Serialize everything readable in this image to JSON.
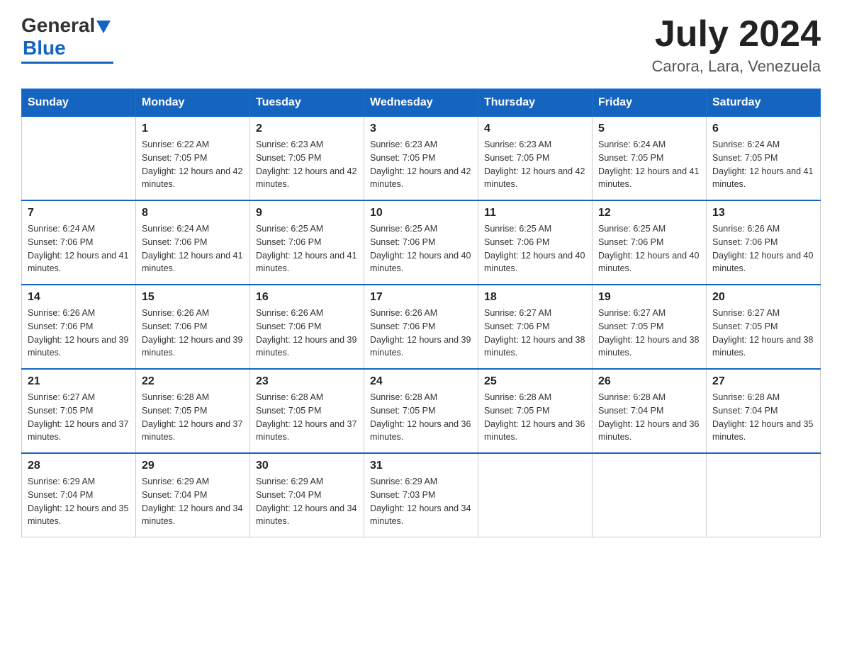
{
  "header": {
    "logo": {
      "general": "General",
      "blue": "Blue"
    },
    "title": "July 2024",
    "location": "Carora, Lara, Venezuela"
  },
  "days_of_week": [
    "Sunday",
    "Monday",
    "Tuesday",
    "Wednesday",
    "Thursday",
    "Friday",
    "Saturday"
  ],
  "weeks": [
    [
      {
        "day": "",
        "info": ""
      },
      {
        "day": "1",
        "info": "Sunrise: 6:22 AM\nSunset: 7:05 PM\nDaylight: 12 hours and 42 minutes."
      },
      {
        "day": "2",
        "info": "Sunrise: 6:23 AM\nSunset: 7:05 PM\nDaylight: 12 hours and 42 minutes."
      },
      {
        "day": "3",
        "info": "Sunrise: 6:23 AM\nSunset: 7:05 PM\nDaylight: 12 hours and 42 minutes."
      },
      {
        "day": "4",
        "info": "Sunrise: 6:23 AM\nSunset: 7:05 PM\nDaylight: 12 hours and 42 minutes."
      },
      {
        "day": "5",
        "info": "Sunrise: 6:24 AM\nSunset: 7:05 PM\nDaylight: 12 hours and 41 minutes."
      },
      {
        "day": "6",
        "info": "Sunrise: 6:24 AM\nSunset: 7:05 PM\nDaylight: 12 hours and 41 minutes."
      }
    ],
    [
      {
        "day": "7",
        "info": "Sunrise: 6:24 AM\nSunset: 7:06 PM\nDaylight: 12 hours and 41 minutes."
      },
      {
        "day": "8",
        "info": "Sunrise: 6:24 AM\nSunset: 7:06 PM\nDaylight: 12 hours and 41 minutes."
      },
      {
        "day": "9",
        "info": "Sunrise: 6:25 AM\nSunset: 7:06 PM\nDaylight: 12 hours and 41 minutes."
      },
      {
        "day": "10",
        "info": "Sunrise: 6:25 AM\nSunset: 7:06 PM\nDaylight: 12 hours and 40 minutes."
      },
      {
        "day": "11",
        "info": "Sunrise: 6:25 AM\nSunset: 7:06 PM\nDaylight: 12 hours and 40 minutes."
      },
      {
        "day": "12",
        "info": "Sunrise: 6:25 AM\nSunset: 7:06 PM\nDaylight: 12 hours and 40 minutes."
      },
      {
        "day": "13",
        "info": "Sunrise: 6:26 AM\nSunset: 7:06 PM\nDaylight: 12 hours and 40 minutes."
      }
    ],
    [
      {
        "day": "14",
        "info": "Sunrise: 6:26 AM\nSunset: 7:06 PM\nDaylight: 12 hours and 39 minutes."
      },
      {
        "day": "15",
        "info": "Sunrise: 6:26 AM\nSunset: 7:06 PM\nDaylight: 12 hours and 39 minutes."
      },
      {
        "day": "16",
        "info": "Sunrise: 6:26 AM\nSunset: 7:06 PM\nDaylight: 12 hours and 39 minutes."
      },
      {
        "day": "17",
        "info": "Sunrise: 6:26 AM\nSunset: 7:06 PM\nDaylight: 12 hours and 39 minutes."
      },
      {
        "day": "18",
        "info": "Sunrise: 6:27 AM\nSunset: 7:06 PM\nDaylight: 12 hours and 38 minutes."
      },
      {
        "day": "19",
        "info": "Sunrise: 6:27 AM\nSunset: 7:05 PM\nDaylight: 12 hours and 38 minutes."
      },
      {
        "day": "20",
        "info": "Sunrise: 6:27 AM\nSunset: 7:05 PM\nDaylight: 12 hours and 38 minutes."
      }
    ],
    [
      {
        "day": "21",
        "info": "Sunrise: 6:27 AM\nSunset: 7:05 PM\nDaylight: 12 hours and 37 minutes."
      },
      {
        "day": "22",
        "info": "Sunrise: 6:28 AM\nSunset: 7:05 PM\nDaylight: 12 hours and 37 minutes."
      },
      {
        "day": "23",
        "info": "Sunrise: 6:28 AM\nSunset: 7:05 PM\nDaylight: 12 hours and 37 minutes."
      },
      {
        "day": "24",
        "info": "Sunrise: 6:28 AM\nSunset: 7:05 PM\nDaylight: 12 hours and 36 minutes."
      },
      {
        "day": "25",
        "info": "Sunrise: 6:28 AM\nSunset: 7:05 PM\nDaylight: 12 hours and 36 minutes."
      },
      {
        "day": "26",
        "info": "Sunrise: 6:28 AM\nSunset: 7:04 PM\nDaylight: 12 hours and 36 minutes."
      },
      {
        "day": "27",
        "info": "Sunrise: 6:28 AM\nSunset: 7:04 PM\nDaylight: 12 hours and 35 minutes."
      }
    ],
    [
      {
        "day": "28",
        "info": "Sunrise: 6:29 AM\nSunset: 7:04 PM\nDaylight: 12 hours and 35 minutes."
      },
      {
        "day": "29",
        "info": "Sunrise: 6:29 AM\nSunset: 7:04 PM\nDaylight: 12 hours and 34 minutes."
      },
      {
        "day": "30",
        "info": "Sunrise: 6:29 AM\nSunset: 7:04 PM\nDaylight: 12 hours and 34 minutes."
      },
      {
        "day": "31",
        "info": "Sunrise: 6:29 AM\nSunset: 7:03 PM\nDaylight: 12 hours and 34 minutes."
      },
      {
        "day": "",
        "info": ""
      },
      {
        "day": "",
        "info": ""
      },
      {
        "day": "",
        "info": ""
      }
    ]
  ]
}
